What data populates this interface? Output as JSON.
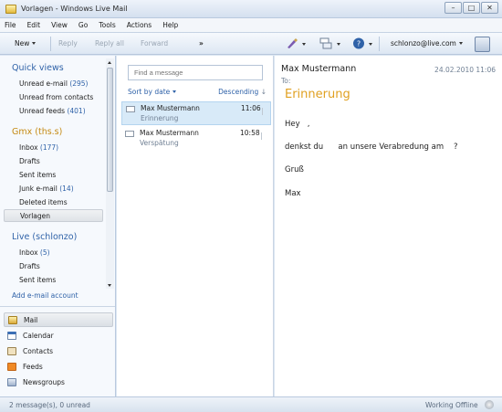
{
  "window": {
    "title": "Vorlagen - Windows Live Mail",
    "min": "–",
    "max": "□",
    "close": "✕"
  },
  "menu": [
    "File",
    "Edit",
    "View",
    "Go",
    "Tools",
    "Actions",
    "Help"
  ],
  "toolbar": {
    "new": "New",
    "reply": "Reply",
    "reply_all": "Reply all",
    "forward": "Forward",
    "more": "»",
    "account": "schlonzo@live.com"
  },
  "sidebar": {
    "quick_views": {
      "title": "Quick views",
      "items": [
        {
          "label": "Unread e-mail",
          "count": "(295)"
        },
        {
          "label": "Unread from contacts",
          "count": ""
        },
        {
          "label": "Unread feeds",
          "count": "(401)"
        }
      ]
    },
    "gmx": {
      "title": "Gmx (ths.s)",
      "items": [
        {
          "label": "Inbox",
          "count": "(177)"
        },
        {
          "label": "Drafts",
          "count": ""
        },
        {
          "label": "Sent items",
          "count": ""
        },
        {
          "label": "Junk e-mail",
          "count": "(14)"
        },
        {
          "label": "Deleted items",
          "count": ""
        },
        {
          "label": "Vorlagen",
          "count": ""
        }
      ]
    },
    "live": {
      "title": "Live (schlonzo)",
      "items": [
        {
          "label": "Inbox",
          "count": "(5)"
        },
        {
          "label": "Drafts",
          "count": ""
        },
        {
          "label": "Sent items",
          "count": ""
        }
      ]
    },
    "add_account": "Add e-mail account",
    "nav": [
      "Mail",
      "Calendar",
      "Contacts",
      "Feeds",
      "Newsgroups"
    ]
  },
  "list": {
    "search_placeholder": "Find a message",
    "sort_by": "Sort by date",
    "order": "Descending",
    "messages": [
      {
        "from": "Max Mustermann",
        "subject": "Erinnerung",
        "time": "11:06"
      },
      {
        "from": "Max Mustermann",
        "subject": "Verspätung",
        "time": "10:58"
      }
    ]
  },
  "reading": {
    "from": "Max Mustermann",
    "date": "24.02.2010 11:06",
    "to": "To:",
    "subject": "Erinnerung",
    "lines": [
      "Hey   ,",
      "denkst du      an unsere Verabredung am    ?",
      "Gruß",
      "Max"
    ]
  },
  "status": {
    "left": "2 message(s), 0 unread",
    "right": "Working Offline"
  },
  "colors": {
    "accent_blue": "#2f62a8",
    "gmx_orange": "#c58a12",
    "subject_orange": "#e0a020",
    "selected_row": "#d8eaf8"
  }
}
